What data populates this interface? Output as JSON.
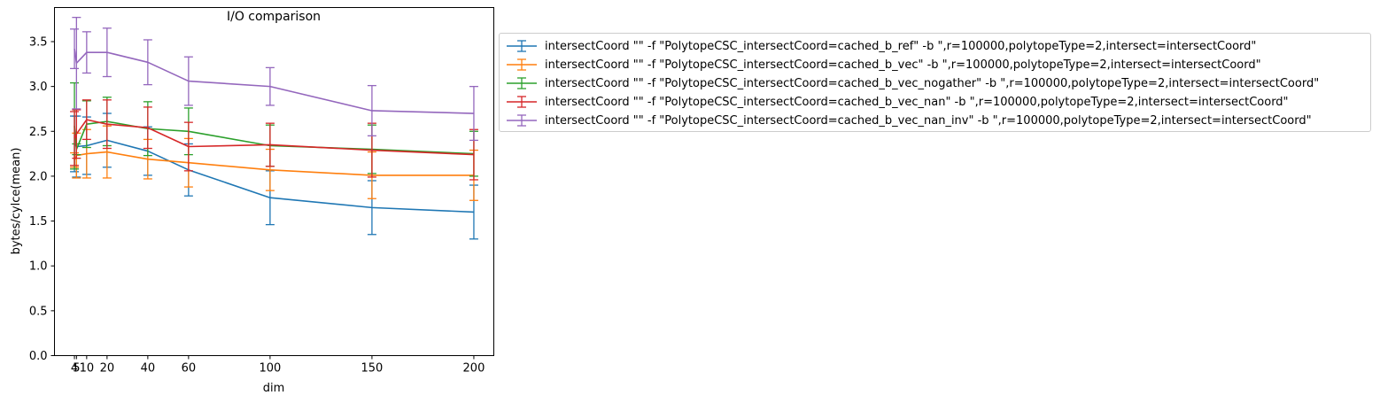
{
  "chart_data": {
    "type": "line",
    "title": "I/O comparison",
    "xlabel": "dim",
    "ylabel": "bytes/cylce(mean)",
    "x": [
      4,
      5,
      10,
      20,
      40,
      60,
      100,
      150,
      200
    ],
    "xticks": [
      4,
      5,
      10,
      20,
      40,
      60,
      100,
      150,
      200
    ],
    "xtick_labels": [
      "4",
      "5",
      "10",
      "20",
      "40",
      "60",
      "100",
      "150",
      "200"
    ],
    "xlim": [
      -5.8,
      209.8
    ],
    "ylim": [
      0,
      3.88
    ],
    "yticks": [
      0.0,
      0.5,
      1.0,
      1.5,
      2.0,
      2.5,
      3.0,
      3.5
    ],
    "ytick_labels": [
      "0.0",
      "0.5",
      "1.0",
      "1.5",
      "2.0",
      "2.5",
      "3.0",
      "3.5"
    ],
    "grid": false,
    "legend_position": "outside-right-top",
    "error_bars": true,
    "series": [
      {
        "name": "intersectCoord \"\" -f \"PolytopeCSC_intersectCoord=cached_b_ref\" -b \",r=100000,polytopeType=2,intersect=intersectCoord\"",
        "color": "#1f77b4",
        "values": [
          2.36,
          2.33,
          2.34,
          2.4,
          2.28,
          2.07,
          1.76,
          1.65,
          1.6
        ],
        "errors": [
          0.31,
          0.34,
          0.32,
          0.3,
          0.27,
          0.29,
          0.3,
          0.3,
          0.3
        ]
      },
      {
        "name": "intersectCoord \"\" -f \"PolytopeCSC_intersectCoord=cached_b_vec\" -b \",r=100000,polytopeType=2,intersect=intersectCoord\"",
        "color": "#ff7f0e",
        "values": [
          2.18,
          2.23,
          2.25,
          2.27,
          2.19,
          2.15,
          2.07,
          2.01,
          2.01
        ],
        "errors": [
          0.08,
          0.25,
          0.27,
          0.29,
          0.22,
          0.27,
          0.23,
          0.26,
          0.28
        ]
      },
      {
        "name": "intersectCoord \"\" -f \"PolytopeCSC_intersectCoord=cached_b_vec_nogather\" -b \",r=100000,polytopeType=2,intersect=intersectCoord\"",
        "color": "#2ca02c",
        "values": [
          2.56,
          2.3,
          2.58,
          2.61,
          2.53,
          2.5,
          2.34,
          2.3,
          2.25
        ],
        "errors": [
          0.48,
          0.06,
          0.26,
          0.27,
          0.3,
          0.26,
          0.23,
          0.27,
          0.25
        ]
      },
      {
        "name": "intersectCoord \"\" -f \"PolytopeCSC_intersectCoord=cached_b_vec_nan\" -b \",r=100000,polytopeType=2,intersect=intersectCoord\"",
        "color": "#d62728",
        "values": [
          2.42,
          2.47,
          2.63,
          2.58,
          2.54,
          2.33,
          2.35,
          2.29,
          2.24
        ],
        "errors": [
          0.3,
          0.27,
          0.22,
          0.27,
          0.23,
          0.27,
          0.24,
          0.3,
          0.28
        ]
      },
      {
        "name": "intersectCoord \"\" -f \"PolytopeCSC_intersectCoord=cached_b_vec_nan_inv\" -b \",r=100000,polytopeType=2,intersect=intersectCoord\"",
        "color": "#9467bd",
        "values": [
          3.42,
          3.26,
          3.38,
          3.38,
          3.27,
          3.06,
          3.0,
          2.73,
          2.7
        ],
        "errors": [
          0.22,
          0.51,
          0.23,
          0.27,
          0.25,
          0.27,
          0.21,
          0.28,
          0.3
        ]
      }
    ]
  }
}
